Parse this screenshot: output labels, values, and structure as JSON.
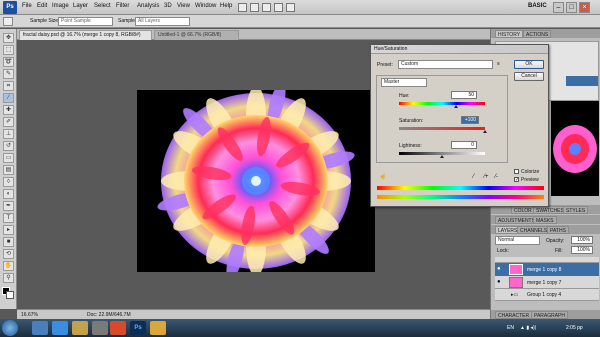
{
  "menu": {
    "logo": "Ps",
    "items": [
      "File",
      "Edit",
      "Image",
      "Layer",
      "Select",
      "Filter",
      "Analysis",
      "3D",
      "View",
      "Window",
      "Help"
    ],
    "workspace": "BASIC"
  },
  "options": {
    "sample_size_label": "Sample Size:",
    "sample_size_value": "Point Sample",
    "sample_label": "Sample:",
    "sample_value": "All Layers"
  },
  "docs": {
    "tab1": "fractal daisy.psd @ 16.7% (merge 1 copy 8, RGB/8#)",
    "tab2": "Untitled-1 @ 66.7% (RGB/8)"
  },
  "status": {
    "zoom": "16.67%",
    "doc": "Doc: 22.9M/646.7M"
  },
  "dialog": {
    "title": "Hue/Saturation",
    "preset_label": "Preset:",
    "preset_value": "Custom",
    "ok": "OK",
    "cancel": "Cancel",
    "channel": "Master",
    "hue_label": "Hue:",
    "hue_value": "50",
    "saturation_label": "Saturation:",
    "saturation_value": "+100",
    "lightness_label": "Lightness:",
    "lightness_value": "0",
    "colorize": "Colorize",
    "preview": "Preview"
  },
  "panels": {
    "history": "HISTORY",
    "actions": "ACTIONS",
    "color": "COLOR",
    "swatches": "SWATCHES",
    "styles": "STYLES",
    "adjustments": "ADJUSTMENTS",
    "masks": "MASKS",
    "layers": "LAYERS",
    "channels": "CHANNELS",
    "paths": "PATHS",
    "blend_mode": "Normal",
    "opacity_label": "Opacity:",
    "opacity_value": "100%",
    "lock_label": "Lock:",
    "fill_label": "Fill:",
    "fill_value": "100%",
    "layers_list": [
      "merge 1 copy 8",
      "merge 1 copy 7",
      "Group 1 copy 4"
    ],
    "character": "CHARACTER",
    "paragraph": "PARAGRAPH"
  },
  "taskbar": {
    "language": "EN",
    "time": "2:05 pp"
  },
  "colors": {
    "accent": "#1c4fa0",
    "selection": "#3a6ea5"
  }
}
